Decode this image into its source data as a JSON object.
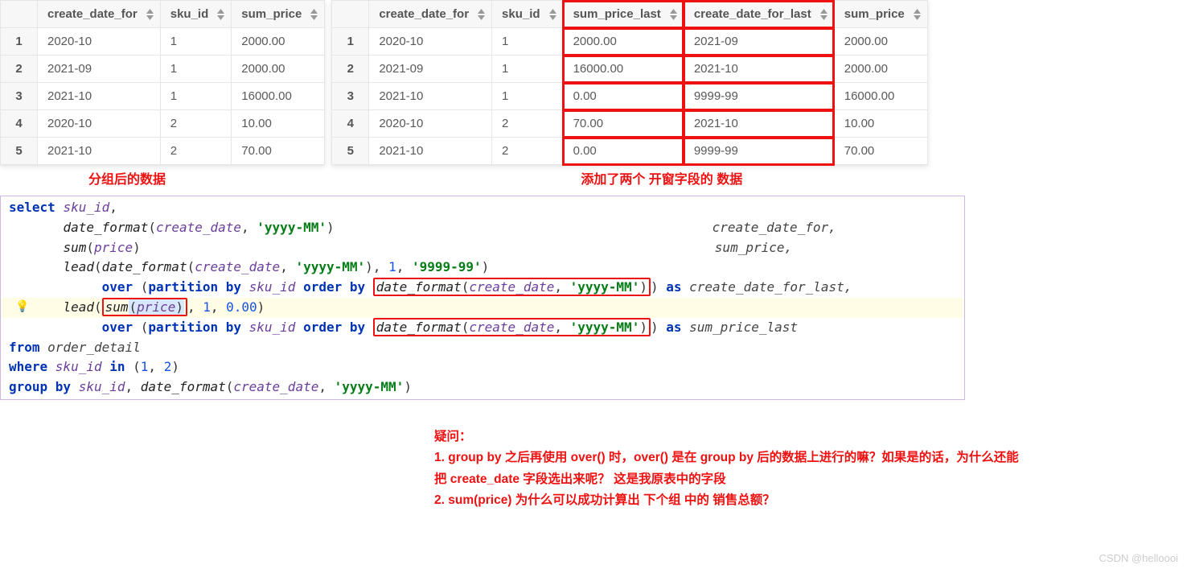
{
  "table_left": {
    "headers": [
      "create_date_for",
      "sku_id",
      "sum_price"
    ],
    "rows": [
      {
        "n": "1",
        "c": [
          "2020-10",
          "1",
          "2000.00"
        ]
      },
      {
        "n": "2",
        "c": [
          "2021-09",
          "1",
          "2000.00"
        ]
      },
      {
        "n": "3",
        "c": [
          "2021-10",
          "1",
          "16000.00"
        ]
      },
      {
        "n": "4",
        "c": [
          "2020-10",
          "2",
          "10.00"
        ]
      },
      {
        "n": "5",
        "c": [
          "2021-10",
          "2",
          "70.00"
        ]
      }
    ],
    "caption": "分组后的数据"
  },
  "table_right": {
    "headers": [
      "create_date_for",
      "sku_id",
      "sum_price_last",
      "create_date_for_last",
      "sum_price"
    ],
    "highlight_cols": [
      2,
      3
    ],
    "rows": [
      {
        "n": "1",
        "c": [
          "2020-10",
          "1",
          "2000.00",
          "2021-09",
          "2000.00"
        ]
      },
      {
        "n": "2",
        "c": [
          "2021-09",
          "1",
          "16000.00",
          "2021-10",
          "2000.00"
        ]
      },
      {
        "n": "3",
        "c": [
          "2021-10",
          "1",
          "0.00",
          "9999-99",
          "16000.00"
        ]
      },
      {
        "n": "4",
        "c": [
          "2020-10",
          "2",
          "70.00",
          "2021-10",
          "10.00"
        ]
      },
      {
        "n": "5",
        "c": [
          "2021-10",
          "2",
          "0.00",
          "9999-99",
          "70.00"
        ]
      }
    ],
    "caption": "添加了两个 开窗字段的   数据"
  },
  "code": {
    "l1_select": "select ",
    "l1_sku": "sku_id",
    "l1_comma": ",",
    "l2_pad": "       ",
    "l2_fn": "date_format",
    "l2_open": "(",
    "l2_cd": "create_date",
    "l2_c": ", ",
    "l2_str": "'yyyy-MM'",
    "l2_close": ")",
    "l2_as": "create_date_for,",
    "l3_pad": "       ",
    "l3_fn": "sum",
    "l3_open": "(",
    "l3_p": "price",
    "l3_close": ")",
    "l3_as": "sum_price,",
    "l4_pad": "       ",
    "l4_fn": "lead",
    "l4_open": "(",
    "l4_df": "date_format",
    "l4_open2": "(",
    "l4_cd": "create_date",
    "l4_c2": ", ",
    "l4_str": "'yyyy-MM'",
    "l4_close2": ")",
    "l4_c3": ", ",
    "l4_n1": "1",
    "l4_c4": ", ",
    "l4_str2": "'9999-99'",
    "l4_close": ")",
    "l5_pad": "            ",
    "l5_over": "over ",
    "l5_open": "(",
    "l5_pb": "partition by ",
    "l5_sku": "sku_id ",
    "l5_ob": "order by ",
    "l5_box_df": "date_format",
    "l5_box_open": "(",
    "l5_box_cd": "create_date",
    "l5_box_c": ", ",
    "l5_box_str": "'yyyy-MM'",
    "l5_box_close": ")",
    "l5_close": ") ",
    "l5_as": "as ",
    "l5_alias": "create_date_for_last,",
    "l6_pad": "       ",
    "l6_fn": "lead",
    "l6_open": "(",
    "l6_box_sum": "sum",
    "l6_box_open": "(",
    "l6_box_p": "price",
    "l6_box_close": ")",
    "l6_c": ", ",
    "l6_n1": "1",
    "l6_c2": ", ",
    "l6_n2": "0.00",
    "l6_close": ")",
    "l7_pad": "            ",
    "l7_over": "over ",
    "l7_open": "(",
    "l7_pb": "partition by ",
    "l7_sku": "sku_id ",
    "l7_ob": "order by ",
    "l7_box_df": "date_format",
    "l7_box_open": "(",
    "l7_box_cd": "create_date",
    "l7_box_c": ", ",
    "l7_box_str": "'yyyy-MM'",
    "l7_box_close": ")",
    "l7_close": ") ",
    "l7_as": "as ",
    "l7_alias": "sum_price_last",
    "l8_from": "from ",
    "l8_tbl": "order_detail",
    "l9_where": "where ",
    "l9_sku": "sku_id ",
    "l9_in": "in ",
    "l9_open": "(",
    "l9_n1": "1",
    "l9_c": ", ",
    "l9_n2": "2",
    "l9_close": ")",
    "l10_gb": "group by ",
    "l10_sku": "sku_id",
    "l10_c": ", ",
    "l10_df": "date_format",
    "l10_open": "(",
    "l10_cd": "create_date",
    "l10_c2": ", ",
    "l10_str": "'yyyy-MM'",
    "l10_close": ")"
  },
  "questions": {
    "title": "疑问：",
    "q1": "1. group by 之后再使用 over() 时，over() 是在 group by 后的数据上进行的嘛？如果是的话，为什么还能",
    "q1b": "    把 create_date 字段选出来呢？   这是我原表中的字段",
    "q2": "2. sum(price) 为什么可以成功计算出 下个组 中的 销售总额？"
  },
  "watermark": "CSDN @helloooi"
}
